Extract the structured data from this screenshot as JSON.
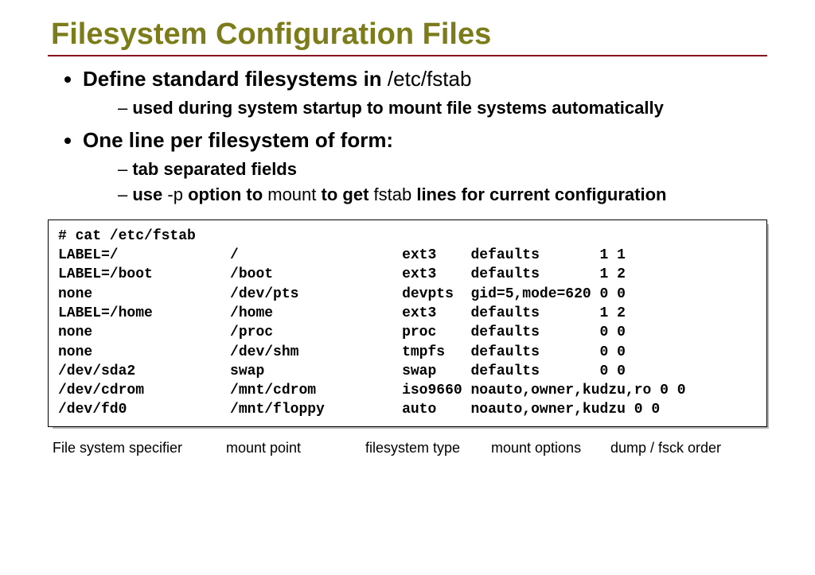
{
  "title": "Filesystem Configuration Files",
  "bullets": {
    "b1": {
      "bold1": "Define standard filesystems in ",
      "plain1": "/etc/fstab"
    },
    "b1_sub1_bold": "used during system startup to mount file systems automatically",
    "b2_bold": "One line per filesystem of form:",
    "b2_sub1_bold": "tab separated fields",
    "b2_sub2": {
      "s1b": "use ",
      "s1": "-p",
      "s2b": " option to ",
      "s2": "mount",
      "s3b": " to get ",
      "s3": "fstab",
      "s4b": " lines for current configuration"
    }
  },
  "code": {
    "cmd": "# cat /etc/fstab",
    "rows": [
      {
        "fs": "LABEL=/",
        "mp": "/",
        "type": "ext3",
        "opts": "defaults",
        "dump": "1 1"
      },
      {
        "fs": "LABEL=/boot",
        "mp": "/boot",
        "type": "ext3",
        "opts": "defaults",
        "dump": "1 2"
      },
      {
        "fs": "none",
        "mp": "/dev/pts",
        "type": "devpts",
        "opts": "gid=5,mode=620",
        "dump": "0 0"
      },
      {
        "fs": "LABEL=/home",
        "mp": "/home",
        "type": "ext3",
        "opts": "defaults",
        "dump": "1 2"
      },
      {
        "fs": "none",
        "mp": "/proc",
        "type": "proc",
        "opts": "defaults",
        "dump": "0 0"
      },
      {
        "fs": "none",
        "mp": "/dev/shm",
        "type": "tmpfs",
        "opts": "defaults",
        "dump": "0 0"
      },
      {
        "fs": "/dev/sda2",
        "mp": "swap",
        "type": "swap",
        "opts": "defaults",
        "dump": "0 0"
      },
      {
        "fs": "/dev/cdrom",
        "mp": "/mnt/cdrom",
        "type": "iso9660",
        "opts": "noauto,owner,kudzu,ro 0 0",
        "dump": ""
      },
      {
        "fs": "/dev/fd0",
        "mp": "/mnt/floppy",
        "type": "auto",
        "opts": "noauto,owner,kudzu 0 0",
        "dump": ""
      }
    ],
    "col_widths": {
      "fs": 20,
      "mp": 20,
      "type": 8,
      "opts": 15,
      "dump": 0
    }
  },
  "captions": {
    "c1": "File system specifier",
    "c2": "mount point",
    "c3": "filesystem type",
    "c4": "mount options",
    "c5": "dump / fsck order"
  }
}
